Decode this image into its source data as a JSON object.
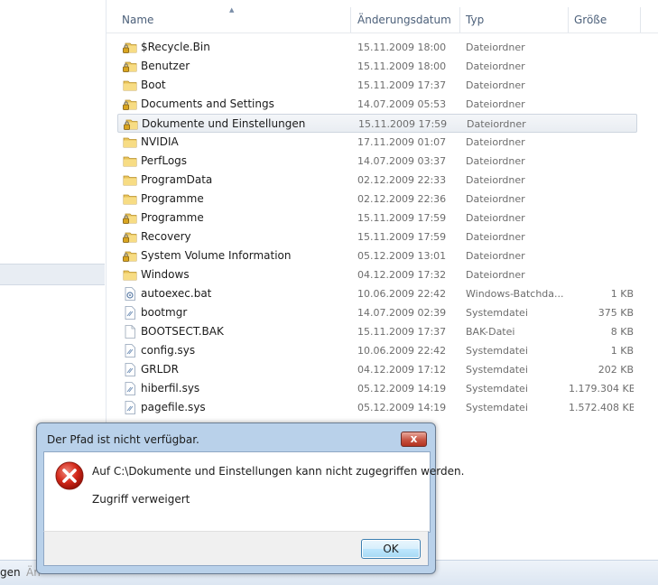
{
  "columns": {
    "name": "Name",
    "date": "Änderungsdatum",
    "type": "Typ",
    "size": "Größe"
  },
  "files": [
    {
      "name": "$Recycle.Bin",
      "date": "15.11.2009 18:00",
      "type": "Dateiordner",
      "size": "",
      "icon": "locked-folder"
    },
    {
      "name": "Benutzer",
      "date": "15.11.2009 18:00",
      "type": "Dateiordner",
      "size": "",
      "icon": "locked-folder"
    },
    {
      "name": "Boot",
      "date": "15.11.2009 17:37",
      "type": "Dateiordner",
      "size": "",
      "icon": "folder"
    },
    {
      "name": "Documents and Settings",
      "date": "14.07.2009 05:53",
      "type": "Dateiordner",
      "size": "",
      "icon": "locked-folder"
    },
    {
      "name": "Dokumente und Einstellungen",
      "date": "15.11.2009 17:59",
      "type": "Dateiordner",
      "size": "",
      "icon": "locked-folder",
      "selected": true
    },
    {
      "name": "NVIDIA",
      "date": "17.11.2009 01:07",
      "type": "Dateiordner",
      "size": "",
      "icon": "folder"
    },
    {
      "name": "PerfLogs",
      "date": "14.07.2009 03:37",
      "type": "Dateiordner",
      "size": "",
      "icon": "folder"
    },
    {
      "name": "ProgramData",
      "date": "02.12.2009 22:33",
      "type": "Dateiordner",
      "size": "",
      "icon": "folder"
    },
    {
      "name": "Programme",
      "date": "02.12.2009 22:36",
      "type": "Dateiordner",
      "size": "",
      "icon": "folder"
    },
    {
      "name": "Programme",
      "date": "15.11.2009 17:59",
      "type": "Dateiordner",
      "size": "",
      "icon": "locked-folder"
    },
    {
      "name": "Recovery",
      "date": "15.11.2009 17:59",
      "type": "Dateiordner",
      "size": "",
      "icon": "locked-folder"
    },
    {
      "name": "System Volume Information",
      "date": "05.12.2009 13:01",
      "type": "Dateiordner",
      "size": "",
      "icon": "locked-folder"
    },
    {
      "name": "Windows",
      "date": "04.12.2009 17:32",
      "type": "Dateiordner",
      "size": "",
      "icon": "folder"
    },
    {
      "name": "autoexec.bat",
      "date": "10.06.2009 22:42",
      "type": "Windows-Batchda...",
      "size": "1 KB",
      "icon": "batch-file"
    },
    {
      "name": "bootmgr",
      "date": "14.07.2009 02:39",
      "type": "Systemdatei",
      "size": "375 KB",
      "icon": "system-file"
    },
    {
      "name": "BOOTSECT.BAK",
      "date": "15.11.2009 17:37",
      "type": "BAK-Datei",
      "size": "8 KB",
      "icon": "blank-file"
    },
    {
      "name": "config.sys",
      "date": "10.06.2009 22:42",
      "type": "Systemdatei",
      "size": "1 KB",
      "icon": "system-file"
    },
    {
      "name": "GRLDR",
      "date": "04.12.2009 17:12",
      "type": "Systemdatei",
      "size": "202 KB",
      "icon": "system-file"
    },
    {
      "name": "hiberfil.sys",
      "date": "05.12.2009 14:19",
      "type": "Systemdatei",
      "size": "1.179.304 KB",
      "icon": "system-file"
    },
    {
      "name": "pagefile.sys",
      "date": "05.12.2009 14:19",
      "type": "Systemdatei",
      "size": "1.572.408 KB",
      "icon": "system-file"
    }
  ],
  "status": {
    "text": "gen",
    "text2": "Än"
  },
  "dialog": {
    "title": "Der Pfad ist nicht verfügbar.",
    "close_label": "x",
    "message": "Auf C:\\Dokumente und Einstellungen kann nicht zugegriffen werden.",
    "detail": "Zugriff verweigert",
    "ok_label": "OK",
    "error_icon": "error-icon"
  },
  "colors": {
    "accent": "#3c7fb1",
    "dialog_frame": "#b9d1ea",
    "close_button": "#c75342"
  }
}
